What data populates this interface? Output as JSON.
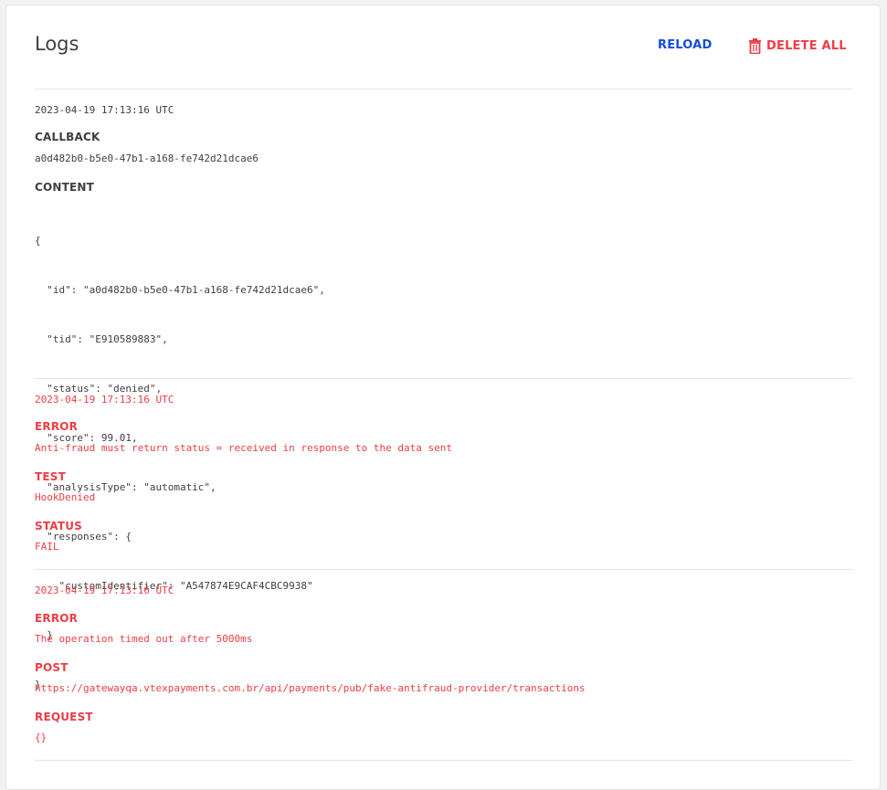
{
  "header": {
    "title": "Logs",
    "reload_label": "RELOAD",
    "delete_all_label": "DELETE ALL"
  },
  "colors": {
    "accent_blue": "#134cd8",
    "danger_red": "#ec3e45",
    "text_dark": "#3f3f40"
  },
  "logs": [
    {
      "timestamp": "2023-04-19 17:13:16 UTC",
      "callback_label": "CALLBACK",
      "callback_value": "a0d482b0-b5e0-47b1-a168-fe742d21dcae6",
      "content_label": "CONTENT",
      "content_lines": [
        "{",
        "  \"id\": \"a0d482b0-b5e0-47b1-a168-fe742d21dcae6\",",
        "  \"tid\": \"E910589883\",",
        "  \"status\": \"denied\",",
        "  \"score\": 99.01,",
        "  \"analysisType\": \"automatic\",",
        "  \"responses\": {",
        "    \"customIdentifier\": \"A547874E9CAF4CBC9938\"",
        "  }",
        "}"
      ]
    },
    {
      "timestamp": "2023-04-19 17:13:16 UTC",
      "error_label": "ERROR",
      "error_value": "Anti-fraud must return status = received in response to the data sent",
      "test_label": "TEST",
      "test_value": "HookDenied",
      "status_label": "STATUS",
      "status_value": "FAIL"
    },
    {
      "timestamp": "2023-04-19 17:13:16 UTC",
      "error_label": "ERROR",
      "error_value": "The operation timed out after 5000ms",
      "post_label": "POST",
      "post_value": "https://gatewayqa.vtexpayments.com.br/api/payments/pub/fake-antifraud-provider/transactions",
      "request_label": "REQUEST",
      "request_value": "{}"
    }
  ]
}
